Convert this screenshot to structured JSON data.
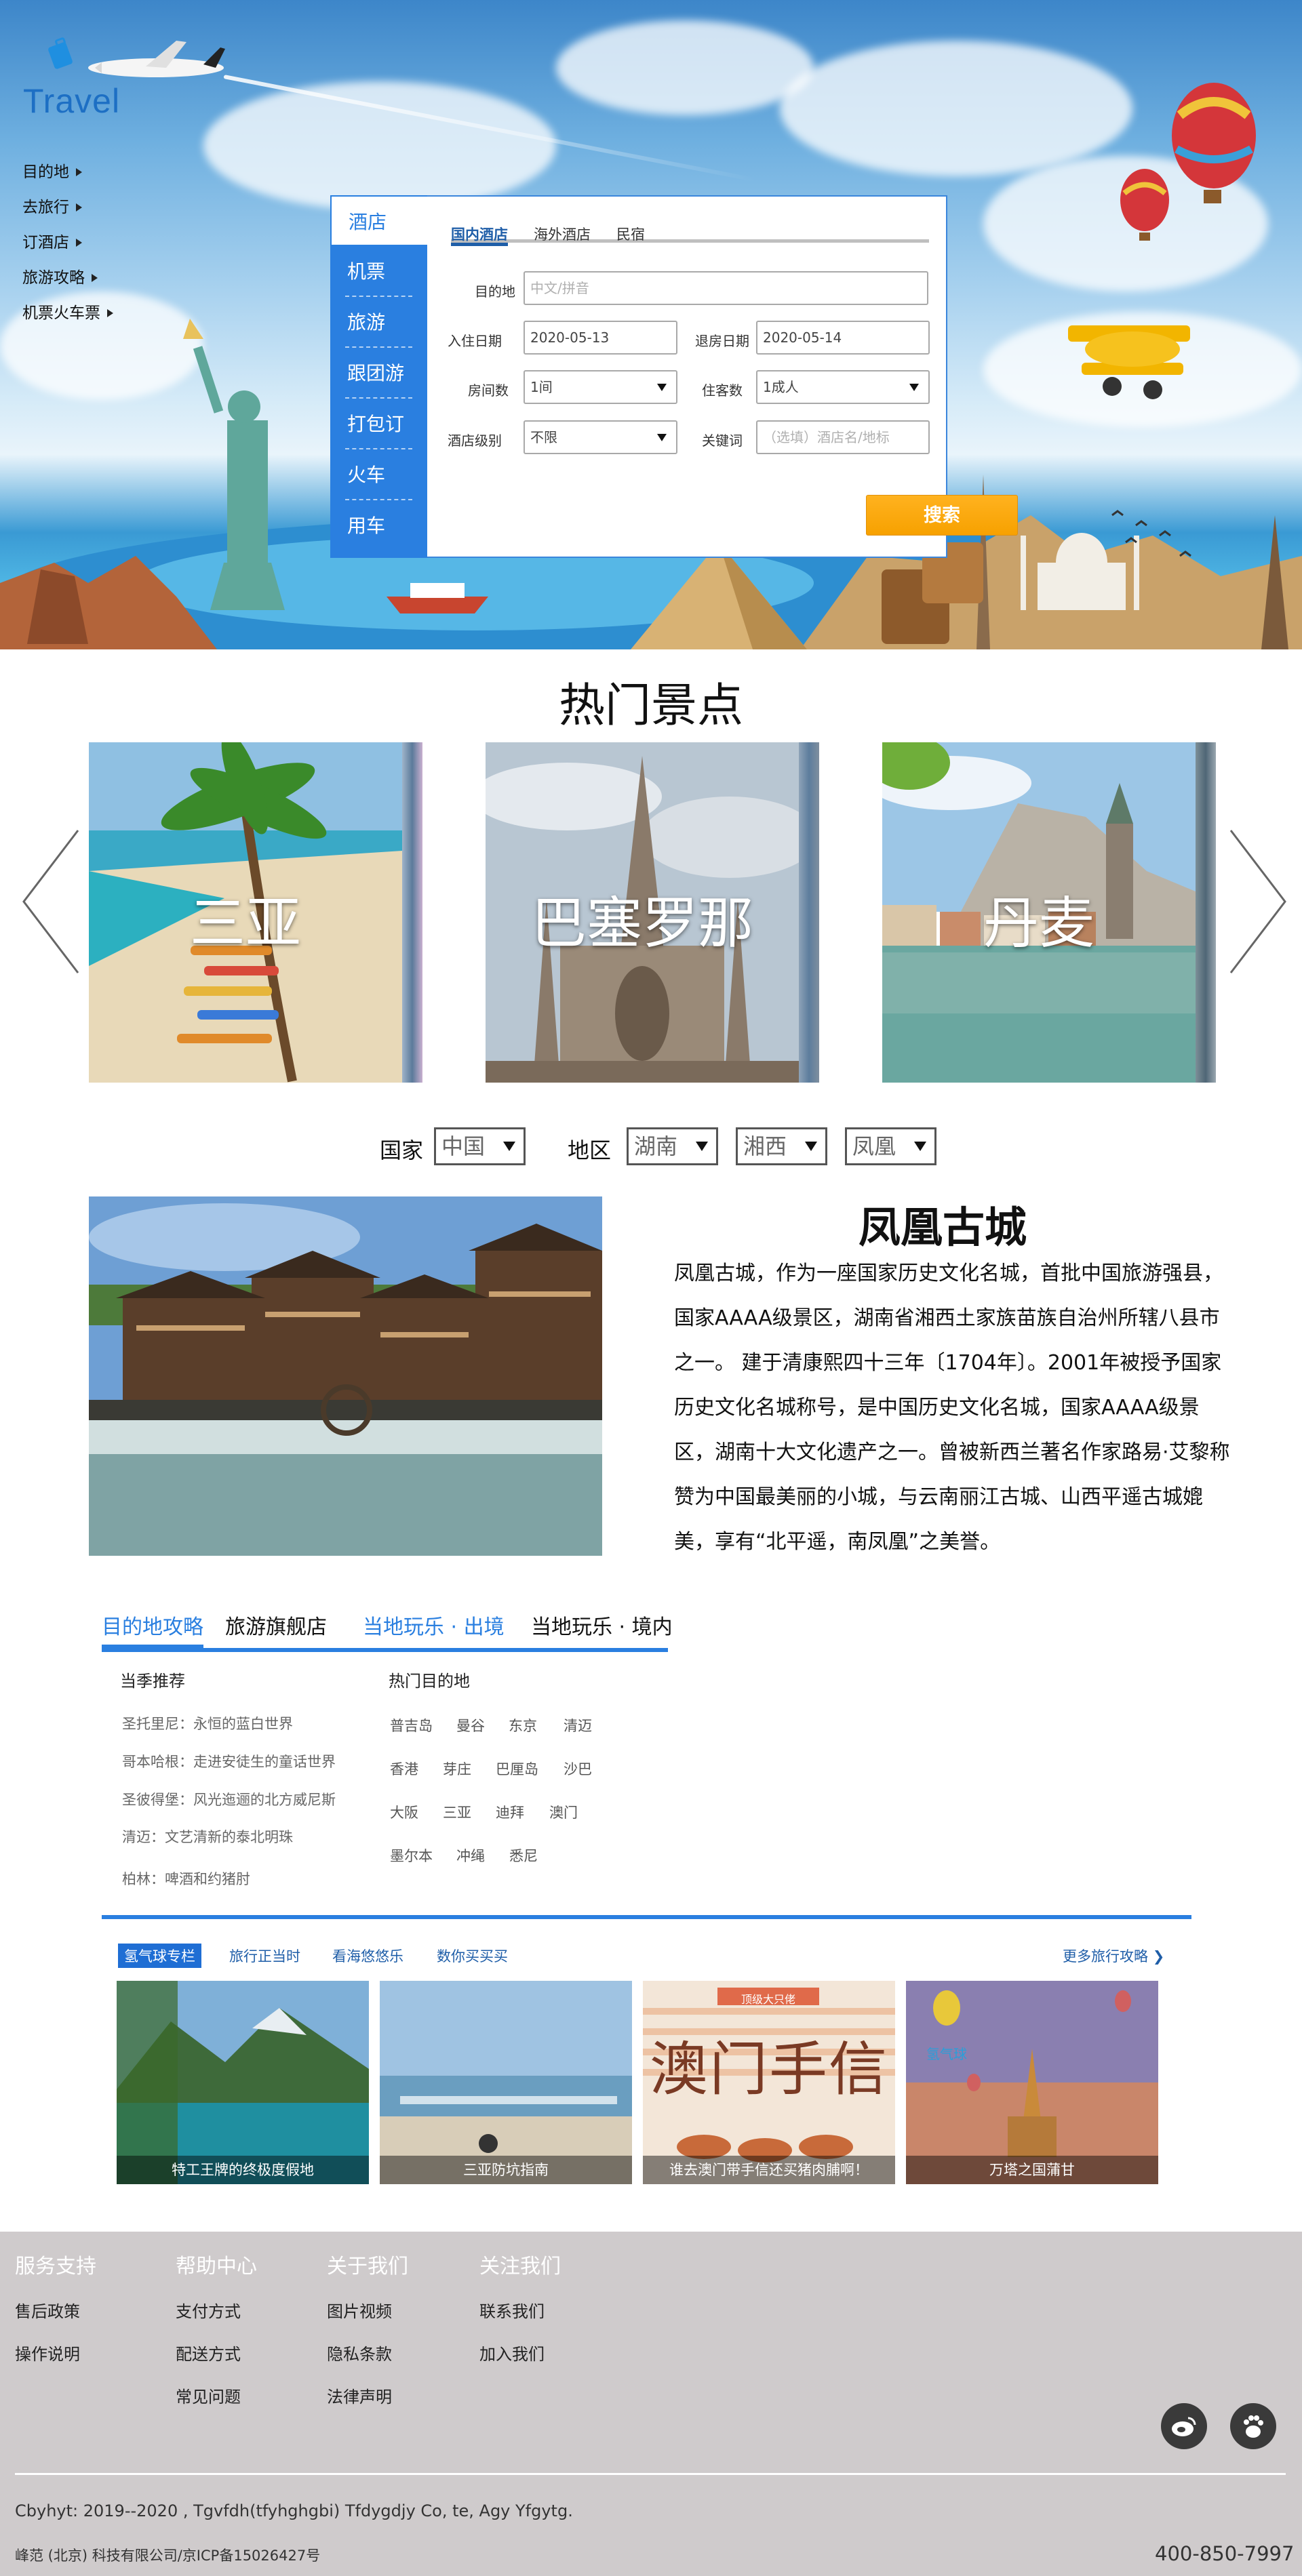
{
  "brand": {
    "logo_text": "Travel"
  },
  "side_nav": [
    "目的地",
    "去旅行",
    "订酒店",
    "旅游攻略",
    "机票火车票"
  ],
  "search_panel": {
    "categories": [
      "酒店",
      "机票",
      "旅游",
      "跟团游",
      "打包订",
      "火车",
      "用车"
    ],
    "tabs": [
      "国内酒店",
      "海外酒店",
      "民宿"
    ],
    "destination": {
      "label": "目的地",
      "placeholder": "中文/拼音"
    },
    "checkin": {
      "label": "入住日期",
      "value": "2020-05-13"
    },
    "checkout": {
      "label": "退房日期",
      "value": "2020-05-14"
    },
    "rooms": {
      "label": "房间数",
      "value": "1间"
    },
    "guests": {
      "label": "住客数",
      "value": "1成人"
    },
    "hotel_level": {
      "label": "酒店级别",
      "value": "不限"
    },
    "keyword": {
      "label": "关键词",
      "placeholder": "（选填）酒店名/地标"
    },
    "search_button": "搜索"
  },
  "hot_spots": {
    "title": "热门景点",
    "items": [
      "三亚",
      "巴塞罗那",
      "丹麦"
    ]
  },
  "region_filter": {
    "country_label": "国家",
    "country_value": "中国",
    "region_label": "地区",
    "province_value": "湖南",
    "prefecture_value": "湘西",
    "county_value": "凤凰"
  },
  "feature": {
    "title": "凤凰古城",
    "description": "凤凰古城，作为一座国家历史文化名城，首批中国旅游强县，国家AAAA级景区，湖南省湘西土家族苗族自治州所辖八县市之一。 建于清康熙四十三年〔1704年〕。2001年被授予国家历史文化名城称号，是中国历史文化名城，国家AAAA级景区，湖南十大文化遗产之一。曾被新西兰著名作家路易·艾黎称赞为中国最美丽的小城，与云南丽江古城、山西平遥古城媲美，享有“北平遥，南凤凰”之美誉。"
  },
  "guide": {
    "tabs": [
      "目的地攻略",
      "旅游旗舰店",
      "当地玩乐 · 出境",
      "当地玩乐 · 境内"
    ],
    "season_heading": "当季推荐",
    "season_items": [
      "圣托里尼：永恒的蓝白世界",
      "哥本哈根：走进安徒生的童话世界",
      "圣彼得堡：风光迤逦的北方威尼斯",
      "清迈：文艺清新的泰北明珠",
      "柏林：啤酒和约猪肘"
    ],
    "hot_dest_heading": "热门目的地",
    "hot_dest_rows": [
      [
        "普吉岛",
        "曼谷",
        "东京",
        "清迈"
      ],
      [
        "香港",
        "芽庄",
        "巴厘岛",
        "沙巴"
      ],
      [
        "大阪",
        "三亚",
        "迪拜",
        "澳门"
      ],
      [
        "墨尔本",
        "冲绳",
        "悉尼"
      ]
    ]
  },
  "strategy": {
    "tabs": [
      "氢气球专栏",
      "旅行正当时",
      "看海悠悠乐",
      "数你买买买"
    ],
    "more_link": "更多旅行攻略",
    "cards": [
      {
        "caption": "特工王牌的终极度假地"
      },
      {
        "caption": "三亚防坑指南"
      },
      {
        "caption": "谁去澳门带手信还买猪肉脯啊！",
        "banner": "澳门手信",
        "tag": "顶级大只佬"
      },
      {
        "caption": "万塔之国蒲甘",
        "tag": "氢气球"
      }
    ]
  },
  "footer": {
    "columns": [
      {
        "heading": "服务支持",
        "items": [
          "售后政策",
          "操作说明"
        ]
      },
      {
        "heading": "帮助中心",
        "items": [
          "支付方式",
          "配送方式",
          "常见问题"
        ]
      },
      {
        "heading": "关于我们",
        "items": [
          "图片视频",
          "隐私条款",
          "法律声明"
        ]
      },
      {
        "heading": "关注我们",
        "items": [
          "联系我们",
          "加入我们"
        ]
      }
    ],
    "social": [
      "weibo-icon",
      "baidu-paw-icon"
    ],
    "copyright": "Cbyhyt: 2019--2020 , Tgvfdh(tfyhghgbi) Tfdygdjy Co, te, Agy Yfgytg.",
    "icp": "峰范 (北京) 科技有限公司/京ICP备15026427号",
    "phone": "400-850-7997"
  }
}
